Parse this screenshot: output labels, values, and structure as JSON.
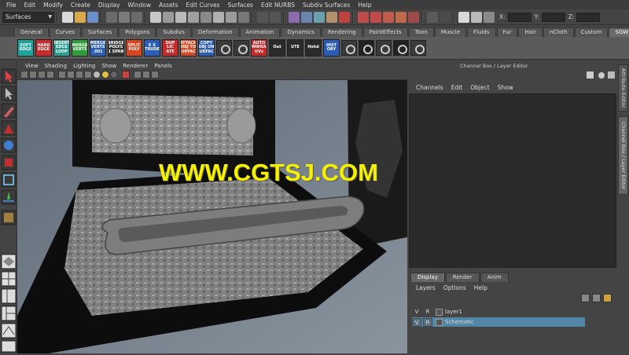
{
  "menubar": [
    "File",
    "Edit",
    "Modify",
    "Create",
    "Display",
    "Window",
    "Assets",
    "Edit Curves",
    "Surfaces",
    "Edit NURBS",
    "Subdiv Surfaces",
    "Help"
  ],
  "status": {
    "mode": "Surfaces",
    "x_label": "X:",
    "y_label": "Y:",
    "z_label": "Z:"
  },
  "shelf_tabs": [
    "General",
    "Curves",
    "Surfaces",
    "Polygons",
    "Subdivs",
    "Deformation",
    "Animation",
    "Dynamics",
    "Rendering",
    "PaintEffects",
    "Toon",
    "Muscle",
    "Fluids",
    "Fur",
    "Hair",
    "nCloth",
    "Custom",
    "SGW"
  ],
  "shelf_active": "SGW",
  "shelf_buttons": [
    {
      "label": "SOFT EDGE",
      "color": "#1fa39b"
    },
    {
      "label": "HARD EDGE",
      "color": "#c92a2a"
    },
    {
      "label": "INSERT EDGE LOOP",
      "color": "#2a9d8f"
    },
    {
      "label": "MERGE VERTS",
      "color": "#2e9d3a"
    },
    {
      "label": "MERGE VERTS .001",
      "color": "#2b5cb8"
    },
    {
      "label": "BRIDGE POLYS 1 SPAN",
      "color": "#333333"
    },
    {
      "label": "SPLIT POLY",
      "color": "#d8451e"
    },
    {
      "label": "E X TRUDE",
      "color": "#2b5cb8"
    },
    {
      "label": "DUP LIC ATE",
      "color": "#c92a2a"
    },
    {
      "label": "ATTACH OBJ TO SURFACE",
      "color": "#d8451e"
    },
    {
      "label": "COPY OBJ ON SURFACE",
      "color": "#2b5cb8"
    },
    {
      "label": "AUTO UNWRAP UVs",
      "color": "#c92a2a"
    },
    {
      "label": "Out",
      "color": "#2a2a2a"
    },
    {
      "label": "UTE",
      "color": "#2a2a2a"
    },
    {
      "label": "Hshd",
      "color": "#2a2a2a"
    },
    {
      "label": "HIST ORY",
      "color": "#2b5cb8"
    }
  ],
  "panel_menu": [
    "View",
    "Shading",
    "Lighting",
    "Show",
    "Renderer",
    "Panels"
  ],
  "viewport": {
    "watermark": "WWW.CGTSJ.COM",
    "colors": {
      "bg": "#6d7a86",
      "watermark": "#f5f000"
    }
  },
  "channel_box": {
    "title": "Channel Box / Layer Editor",
    "menu": [
      "Channels",
      "Edit",
      "Object",
      "Show"
    ]
  },
  "side_tabs": [
    "Attribute Editor",
    "Channel Box / Layer Editor"
  ],
  "layer_editor": {
    "tabs": [
      "Display",
      "Render",
      "Anim"
    ],
    "active_tab": "Display",
    "menu": [
      "Layers",
      "Options",
      "Help"
    ],
    "layers": [
      {
        "v": "V",
        "r": "R",
        "name": "layer1",
        "selected": false
      },
      {
        "v": "V",
        "r": "R",
        "name": "Schematic",
        "selected": true
      }
    ]
  }
}
